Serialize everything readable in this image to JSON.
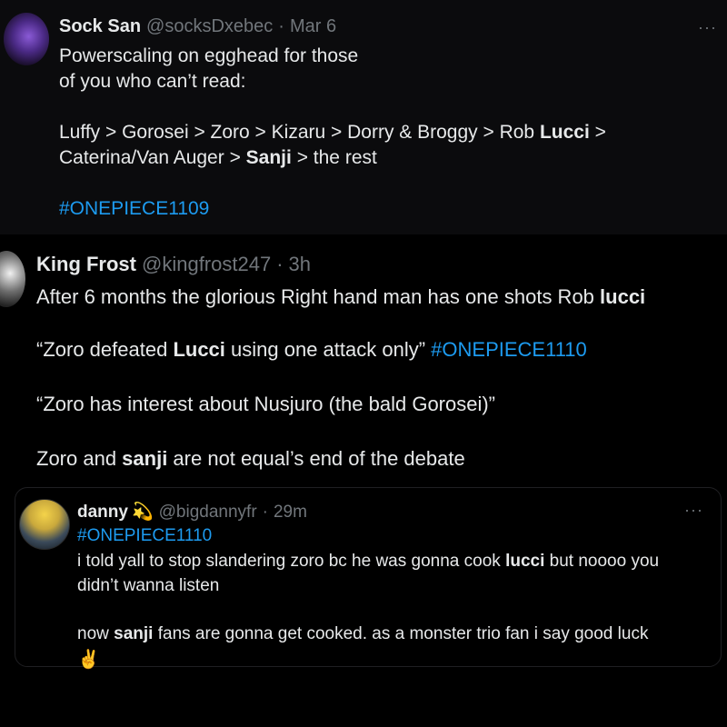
{
  "tweet1": {
    "name": "Sock San",
    "handle": "@socksDxebec",
    "date": "Mar 6",
    "more": "···",
    "line1": "Powerscaling on egghead for those",
    "line2": "of you who can’t read:",
    "line3": "Luffy > Gorosei > Zoro > Kizaru > Dorry & Broggy > Rob ",
    "line3_bold": "Lucci",
    "line3_end": " >",
    "line4a": "Caterina/Van Auger > ",
    "line4_bold": "Sanji",
    "line4b": " > the rest",
    "hashtag": "#ONEPIECE1109"
  },
  "tweet2": {
    "name": "King Frost",
    "handle": "@kingfrost247",
    "date": "3h",
    "line1a": "After 6 months the glorious Right hand man has one shots Rob ",
    "line1_bold": "lucci",
    "line2a": " “Zoro defeated ",
    "line2_bold": "Lucci",
    "line2b": " using one attack only” ",
    "line2_tag": "#ONEPIECE1110",
    "line3": "“Zoro has interest about Nusjuro (the bald Gorosei)”",
    "line4a": "Zoro and ",
    "line4_bold": "sanji",
    "line4b": " are not equal’s end of the debate"
  },
  "tweet3": {
    "name": "danny",
    "emoji": "💫",
    "handle": "@bigdannyfr",
    "date": "29m",
    "more": "···",
    "hashtag": "#ONEPIECE1110",
    "line1a": "i told yall to stop slandering zoro bc he was gonna cook ",
    "line1_bold": "lucci",
    "line1b": " but noooo you",
    "line2": "didn’t wanna listen",
    "line3a": "now ",
    "line3_bold": "sanji",
    "line3b": " fans are gonna get cooked. as a monster trio fan i say good luck",
    "emoji_end": "✌️"
  }
}
